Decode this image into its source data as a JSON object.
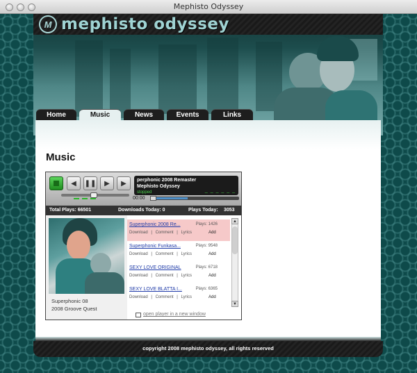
{
  "window": {
    "title": "Mephisto Odyssey"
  },
  "logo": {
    "text": "mephisto odyssey",
    "mark": "M"
  },
  "nav": {
    "tabs": [
      {
        "label": "Home",
        "active": false
      },
      {
        "label": "Music",
        "active": true
      },
      {
        "label": "News",
        "active": false
      },
      {
        "label": "Events",
        "active": false
      },
      {
        "label": "Links",
        "active": false
      }
    ]
  },
  "page": {
    "title": "Music"
  },
  "player": {
    "now_playing": {
      "track": "perphonic 2008 Remaster",
      "artist": "Mephisto Odyssey",
      "status": "stopped",
      "levels": "_ _ _ _ _ _"
    },
    "time": "00:00",
    "stats": {
      "total_plays": "Total Plays: 66501",
      "downloads_today": "Downloads Today: 0",
      "plays_today_label": "Plays Today:",
      "plays_today_value": "3053"
    },
    "album": {
      "caption_line1": "Superphonic 08",
      "caption_line2": "2008 Groove Quest"
    },
    "tracks": [
      {
        "title": "Superphonic 2008 Re...",
        "plays": "Plays: 1426",
        "download": "Download",
        "comment": "Comment",
        "lyrics": "Lyrics",
        "add": "Add",
        "selected": true
      },
      {
        "title": "Superphonic Funkasa...",
        "plays": "Plays: 9548",
        "download": "Download",
        "comment": "Comment",
        "lyrics": "Lyrics",
        "add": "Add",
        "selected": false
      },
      {
        "title": "SEXY LOVE ORIGINAL",
        "plays": "Plays: 6718",
        "download": "Download",
        "comment": "Comment",
        "lyrics": "Lyrics",
        "add": "Add",
        "selected": false
      },
      {
        "title": "SEXY LOVE BLATTA I...",
        "plays": "Plays: 6365",
        "download": "Download",
        "comment": "Comment",
        "lyrics": "Lyrics",
        "add": "Add",
        "selected": false
      }
    ],
    "separator": "|",
    "open_new_window": "open player in a new window"
  },
  "footer": {
    "copyright": "copyright 2008 mephisto odyssey, all rights reserved"
  },
  "colors": {
    "teal_bg": "#0e4a4a",
    "accent_green": "#2dbb2d",
    "link_blue": "#1e3aa8",
    "selected_row": "#f6c9c9"
  }
}
